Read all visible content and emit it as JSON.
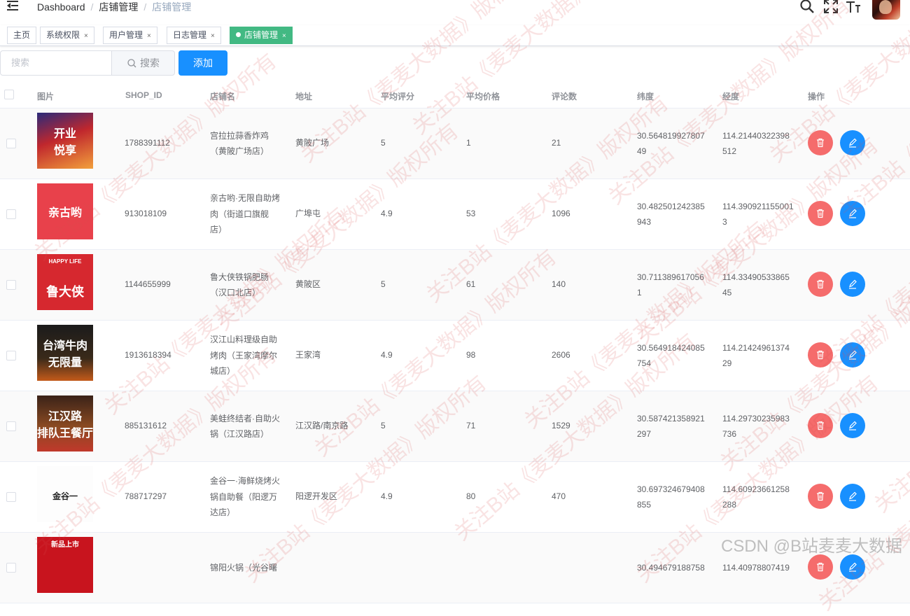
{
  "header": {
    "breadcrumb": [
      "Dashboard",
      "店铺管理",
      "店铺管理"
    ],
    "icons": [
      "hamburger-icon",
      "search-icon",
      "fullscreen-icon",
      "font-size-icon"
    ]
  },
  "tags": [
    {
      "label": "主页",
      "closable": false,
      "active": false
    },
    {
      "label": "系统权限",
      "closable": true,
      "active": false
    },
    {
      "label": "用户管理",
      "closable": true,
      "active": false
    },
    {
      "label": "日志管理",
      "closable": true,
      "active": false
    },
    {
      "label": "店铺管理",
      "closable": true,
      "active": true
    }
  ],
  "toolbar": {
    "search_placeholder": "搜索",
    "search_button": "搜索",
    "add_button": "添加"
  },
  "table": {
    "columns": [
      "图片",
      "SHOP_ID",
      "店铺名",
      "地址",
      "平均评分",
      "平均价格",
      "评论数",
      "纬度",
      "经度",
      "操作"
    ],
    "rows": [
      {
        "shop_id": "1788391112",
        "name": [
          "宫拉拉蒜香炸鸡",
          "（黄陂广场店）"
        ],
        "address": "黄陂广场",
        "rating": "5",
        "price": "1",
        "comments": "21",
        "lat": [
          "30.564819927807",
          "49"
        ],
        "lng": [
          "114.21440322398",
          "512"
        ],
        "thumb": [
          "开业",
          "悦享"
        ]
      },
      {
        "shop_id": "913018109",
        "name": [
          "亲古哟·无限自助烤",
          "肉（街道口旗舰",
          "店）"
        ],
        "address": "广埠屯",
        "rating": "4.9",
        "price": "53",
        "comments": "1096",
        "lat": [
          "30.482501242385",
          "943"
        ],
        "lng": [
          "114.390921155001",
          "3"
        ],
        "thumb": [
          "亲古哟"
        ]
      },
      {
        "shop_id": "1144655999",
        "name": [
          "鲁大侠铁锅肥肠",
          "（汉口北店）"
        ],
        "address": "黄陂区",
        "rating": "5",
        "price": "61",
        "comments": "140",
        "lat": [
          "30.711389617056",
          "1"
        ],
        "lng": [
          "114.33490533865",
          "45"
        ],
        "thumb": [
          "HAPPY LIFE",
          "鲁大侠"
        ]
      },
      {
        "shop_id": "1913618394",
        "name": [
          "汉江山料理级自助",
          "烤肉（王家湾摩尔",
          "城店）"
        ],
        "address": "王家湾",
        "rating": "4.9",
        "price": "98",
        "comments": "2606",
        "lat": [
          "30.564918424085",
          "754"
        ],
        "lng": [
          "114.21424961374",
          "29"
        ],
        "thumb": [
          "台湾牛肉",
          "无限量"
        ]
      },
      {
        "shop_id": "885131612",
        "name": [
          "美蛙终结者·自助火",
          "锅（江汉路店）"
        ],
        "address": "江汉路/南京路",
        "rating": "5",
        "price": "71",
        "comments": "1529",
        "lat": [
          "30.587421358921",
          "297"
        ],
        "lng": [
          "114.29730235983",
          "736"
        ],
        "thumb": [
          "江汉路",
          "排队王餐厅"
        ]
      },
      {
        "shop_id": "788717297",
        "name": [
          "金谷一·海鲜烧烤火",
          "锅自助餐（阳逻万",
          "达店）"
        ],
        "address": "阳逻开发区",
        "rating": "4.9",
        "price": "80",
        "comments": "470",
        "lat": [
          "30.697324679408",
          "855"
        ],
        "lng": [
          "114.60923661258",
          "288"
        ],
        "thumb": [
          "金谷一"
        ]
      },
      {
        "shop_id": "",
        "name": [
          "锦阳火锅（光谷曙"
        ],
        "address": "",
        "rating": "",
        "price": "",
        "comments": "",
        "lat": [
          "30.494679188758"
        ],
        "lng": [
          "114.40978807419"
        ],
        "thumb": [
          "新品上市"
        ]
      }
    ]
  },
  "watermark_text": "CSDN @B站麦麦大数据",
  "overlay_watermark": "关注B站《麦麦大数据》版权所有",
  "colors": {
    "primary": "#1890ff",
    "danger": "#f56c6c",
    "active_tag": "#42b983"
  }
}
